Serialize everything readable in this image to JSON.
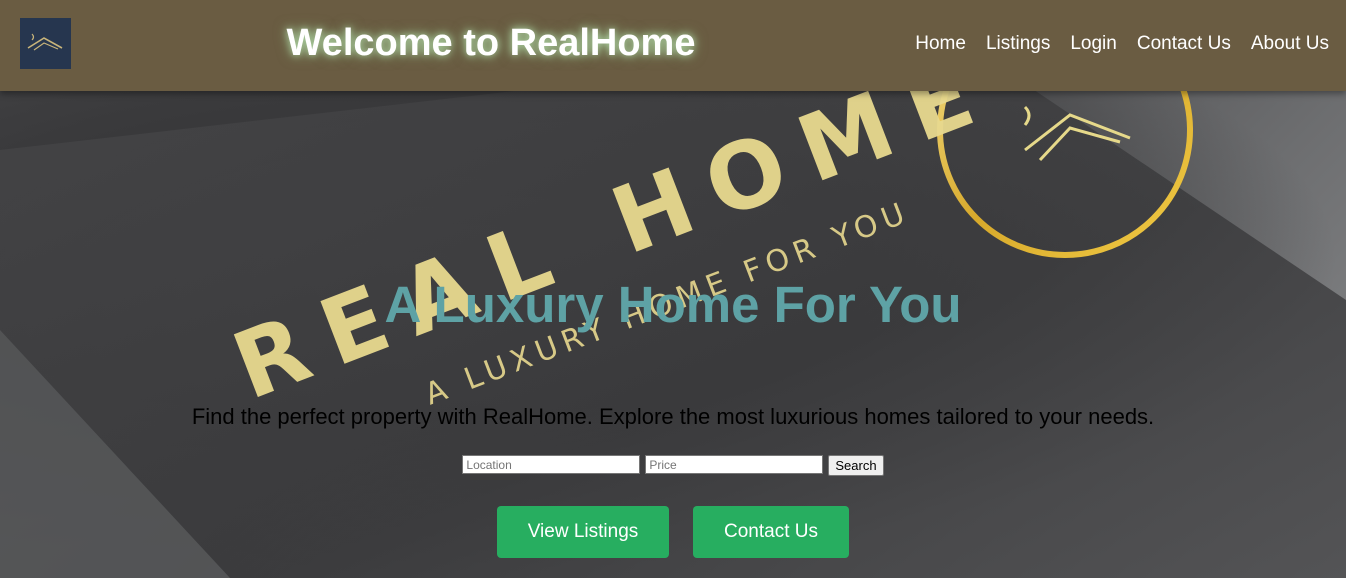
{
  "header": {
    "logo_icon": "house-roof-icon",
    "title": "Welcome to RealHome",
    "nav": [
      {
        "label": "Home"
      },
      {
        "label": "Listings"
      },
      {
        "label": "Login"
      },
      {
        "label": "Contact Us"
      },
      {
        "label": "About Us"
      }
    ]
  },
  "hero": {
    "background_logo": {
      "wordmark": "REAL HOME",
      "tagline": "A LUXURY HOME FOR YOU"
    },
    "heading": "A Luxury Home For You",
    "subheading": "Find the perfect property with RealHome. Explore the most luxurious homes tailored to your needs.",
    "search": {
      "location_placeholder": "Location",
      "price_placeholder": "Price",
      "button_label": "Search"
    },
    "buttons": {
      "view_listings": "View Listings",
      "contact_us": "Contact Us"
    }
  },
  "colors": {
    "header_bg": "#6a5c42",
    "logo_bg": "#26364f",
    "heading": "#5ea2a5",
    "cta": "#27ae60",
    "gold": "#d9c36a"
  }
}
